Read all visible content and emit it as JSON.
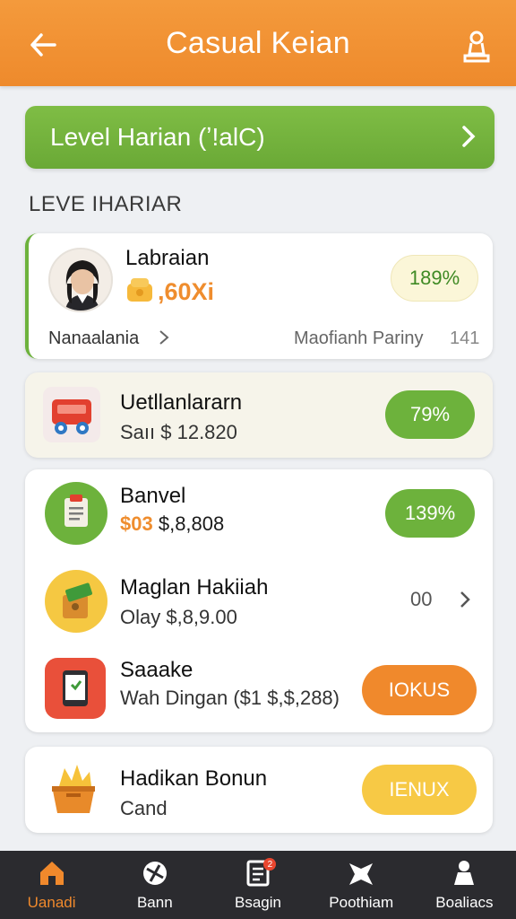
{
  "header": {
    "title": "Casual Keian"
  },
  "banner": {
    "label": "Level Harian (ʼ!alC)"
  },
  "section": {
    "label": "LEVE IHARIAR"
  },
  "card1": {
    "name": "Labraian",
    "value": ",60Xi",
    "link": "Nanaalania",
    "right_text": "Maofianh Pariny",
    "right_num": "141",
    "pill": "189%"
  },
  "card2": {
    "name": "Uetllanlararn",
    "sub": "Saıı $ 12.820",
    "pill": "79%"
  },
  "card3": {
    "rows": [
      {
        "name": "Banvel",
        "sub_prefix": "$03",
        "sub": "$,8,808",
        "pill": "139%"
      },
      {
        "name": "Maglan Hakiiah",
        "sub": "Olay $,8,9.00",
        "count": "00"
      },
      {
        "name": "Saaake",
        "sub": "Wah Dingan ($1 $,$,288)",
        "pill": "IOKUS"
      }
    ]
  },
  "card4": {
    "name": "Hadikan Bonun",
    "sub": "Cand",
    "pill": "IENUX"
  },
  "tabs": [
    {
      "label": "Uanadi",
      "icon": "home-icon"
    },
    {
      "label": "Bann",
      "icon": "ball-icon"
    },
    {
      "label": "Bsagin",
      "icon": "document-icon",
      "badge": "2"
    },
    {
      "label": "Poothiam",
      "icon": "star-icon"
    },
    {
      "label": "Boaliacs",
      "icon": "person-icon"
    }
  ],
  "colors": {
    "orange": "#f0892c",
    "green": "#6db23c",
    "yellow": "#f7c945",
    "tabbar": "#2b2b2f"
  }
}
